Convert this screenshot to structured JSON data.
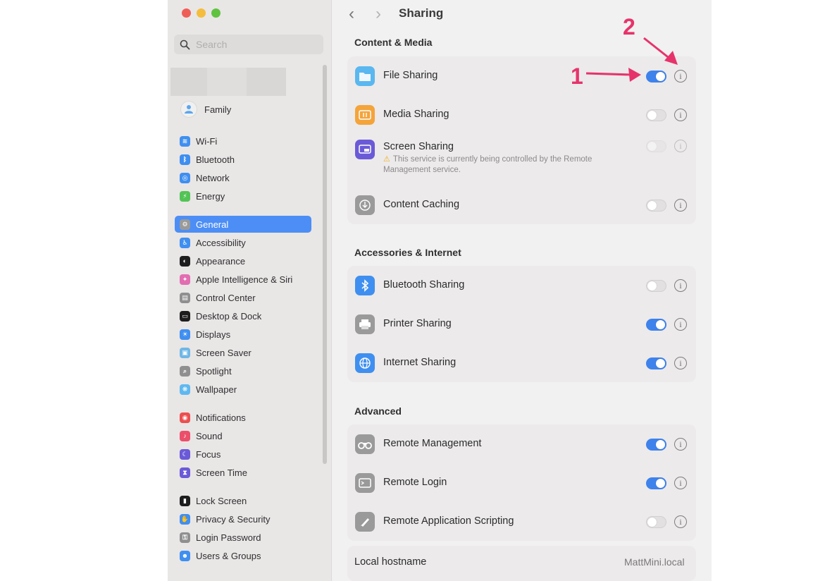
{
  "sidebar": {
    "search_placeholder": "Search",
    "family_label": "Family",
    "groups": [
      [
        {
          "label": "Wi-Fi",
          "icon": "wifi-icon",
          "color": "#3f8ff0",
          "glyph": "≋"
        },
        {
          "label": "Bluetooth",
          "icon": "bluetooth-icon",
          "color": "#3f8ff0",
          "glyph": "ᛒ"
        },
        {
          "label": "Network",
          "icon": "network-icon",
          "color": "#3f8ff0",
          "glyph": "◎"
        },
        {
          "label": "Energy",
          "icon": "energy-icon",
          "color": "#52c455",
          "glyph": "⚡"
        }
      ],
      [
        {
          "label": "General",
          "icon": "gear-icon",
          "color": "#9a9a9a",
          "glyph": "⚙",
          "active": true
        },
        {
          "label": "Accessibility",
          "icon": "accessibility-icon",
          "color": "#3f8ff0",
          "glyph": "♿"
        },
        {
          "label": "Appearance",
          "icon": "appearance-icon",
          "color": "#1d1d1d",
          "glyph": "◐"
        },
        {
          "label": "Apple Intelligence & Siri",
          "icon": "siri-icon",
          "color": "#e26db1",
          "glyph": "✦"
        },
        {
          "label": "Control Center",
          "icon": "control-center-icon",
          "color": "#8f8f8f",
          "glyph": "▤"
        },
        {
          "label": "Desktop & Dock",
          "icon": "desktop-dock-icon",
          "color": "#1d1d1d",
          "glyph": "▭"
        },
        {
          "label": "Displays",
          "icon": "displays-icon",
          "color": "#3f8ff0",
          "glyph": "☀"
        },
        {
          "label": "Screen Saver",
          "icon": "screen-saver-icon",
          "color": "#6fb7e6",
          "glyph": "▣"
        },
        {
          "label": "Spotlight",
          "icon": "spotlight-icon",
          "color": "#8f8f8f",
          "glyph": "⌕"
        },
        {
          "label": "Wallpaper",
          "icon": "wallpaper-icon",
          "color": "#5fb8f0",
          "glyph": "❋"
        }
      ],
      [
        {
          "label": "Notifications",
          "icon": "notifications-icon",
          "color": "#ec4f4f",
          "glyph": "◉"
        },
        {
          "label": "Sound",
          "icon": "sound-icon",
          "color": "#ec4f6a",
          "glyph": "♪"
        },
        {
          "label": "Focus",
          "icon": "focus-icon",
          "color": "#6a5ad8",
          "glyph": "☾"
        },
        {
          "label": "Screen Time",
          "icon": "screen-time-icon",
          "color": "#6a5ad8",
          "glyph": "⧗"
        }
      ],
      [
        {
          "label": "Lock Screen",
          "icon": "lock-screen-icon",
          "color": "#1d1d1d",
          "glyph": "▮"
        },
        {
          "label": "Privacy & Security",
          "icon": "privacy-icon",
          "color": "#3f8ff0",
          "glyph": "✋"
        },
        {
          "label": "Login Password",
          "icon": "login-password-icon",
          "color": "#8f8f8f",
          "glyph": "⚿"
        },
        {
          "label": "Users & Groups",
          "icon": "users-groups-icon",
          "color": "#3f8ff0",
          "glyph": "☻"
        }
      ]
    ]
  },
  "main": {
    "title": "Sharing",
    "sections": [
      {
        "title": "Content & Media",
        "rows": [
          {
            "label": "File Sharing",
            "icon": "folder-icon",
            "color": "#5ab7ef",
            "on": true
          },
          {
            "label": "Media Sharing",
            "icon": "media-sharing-icon",
            "color": "#f4a43b",
            "on": false
          },
          {
            "label": "Screen Sharing",
            "icon": "screen-sharing-icon",
            "color": "#6a5ad8",
            "on": false,
            "disabled": true,
            "note": "This service is currently being controlled by the Remote Management service."
          },
          {
            "label": "Content Caching",
            "icon": "content-caching-icon",
            "color": "#9a9a9a",
            "on": false
          }
        ]
      },
      {
        "title": "Accessories & Internet",
        "rows": [
          {
            "label": "Bluetooth Sharing",
            "icon": "bluetooth-icon",
            "color": "#3f8ff0",
            "on": false
          },
          {
            "label": "Printer Sharing",
            "icon": "printer-icon",
            "color": "#9a9a9a",
            "on": true
          },
          {
            "label": "Internet Sharing",
            "icon": "globe-icon",
            "color": "#3f8ff0",
            "on": true
          }
        ]
      },
      {
        "title": "Advanced",
        "rows": [
          {
            "label": "Remote Management",
            "icon": "binoculars-icon",
            "color": "#9a9a9a",
            "on": true
          },
          {
            "label": "Remote Login",
            "icon": "terminal-icon",
            "color": "#9a9a9a",
            "on": true
          },
          {
            "label": "Remote Application Scripting",
            "icon": "script-icon",
            "color": "#9a9a9a",
            "on": false
          }
        ]
      }
    ],
    "hostname_label": "Local hostname",
    "hostname_value": "MattMini.local"
  },
  "annotations": {
    "one": "1",
    "two": "2",
    "color": "#e6336c"
  }
}
